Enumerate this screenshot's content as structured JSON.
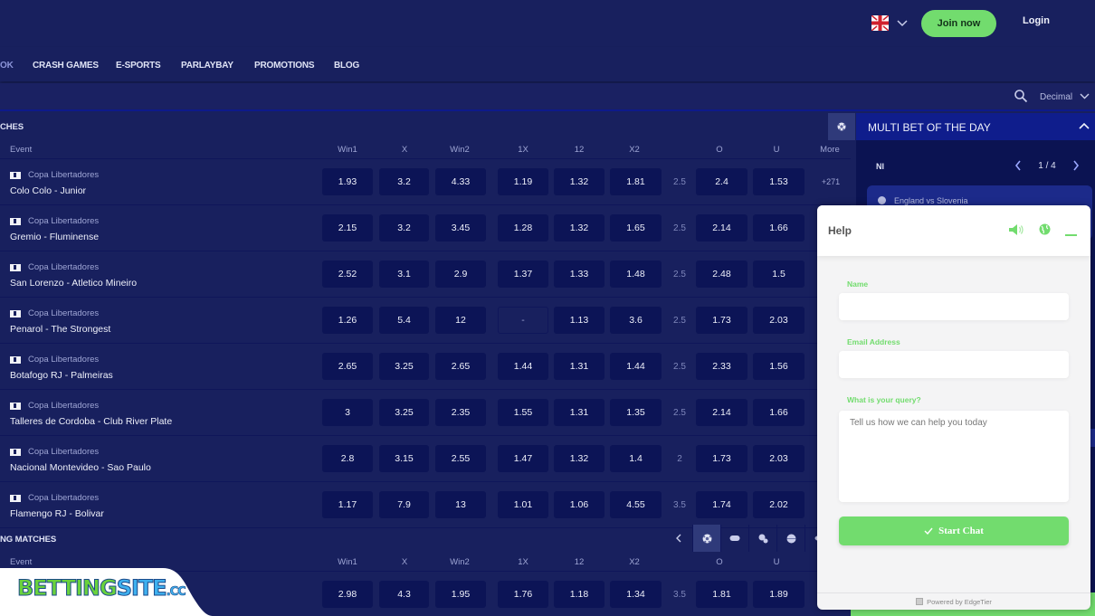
{
  "header": {
    "language_icon": "uk-flag-icon",
    "join_label": "Join now",
    "login_label": "Login"
  },
  "nav": {
    "items": [
      {
        "label": "OK",
        "active": true
      },
      {
        "label": "CRASH GAMES"
      },
      {
        "label": "E-SPORTS"
      },
      {
        "label": "PARLAYBAY"
      },
      {
        "label": "PROMOTIONS"
      },
      {
        "label": "BLOG"
      }
    ]
  },
  "toolbar": {
    "odds_format": "Decimal"
  },
  "columns": {
    "event": "Event",
    "win1": "Win1",
    "x": "X",
    "win2": "Win2",
    "dc1x": "1X",
    "dc12": "12",
    "dcx2": "X2",
    "over": "O",
    "under": "U",
    "more": "More"
  },
  "top_section": {
    "title": "CHES",
    "matches": [
      {
        "league": "Copa Libertadores",
        "name": "Colo Colo - Junior",
        "odds": [
          "1.93",
          "3.2",
          "4.33",
          "1.19",
          "1.32",
          "1.81"
        ],
        "line": "2.5",
        "ou": [
          "2.4",
          "1.53"
        ],
        "more": "+271"
      },
      {
        "league": "Copa Libertadores",
        "name": "Gremio - Fluminense",
        "odds": [
          "2.15",
          "3.2",
          "3.45",
          "1.28",
          "1.32",
          "1.65"
        ],
        "line": "2.5",
        "ou": [
          "2.14",
          "1.66"
        ],
        "more": ""
      },
      {
        "league": "Copa Libertadores",
        "name": "San Lorenzo - Atletico Mineiro",
        "odds": [
          "2.52",
          "3.1",
          "2.9",
          "1.37",
          "1.33",
          "1.48"
        ],
        "line": "2.5",
        "ou": [
          "2.48",
          "1.5"
        ],
        "more": ""
      },
      {
        "league": "Copa Libertadores",
        "name": "Penarol - The Strongest",
        "odds": [
          "1.26",
          "5.4",
          "12",
          "-",
          "1.13",
          "3.6"
        ],
        "line": "2.5",
        "ou": [
          "1.73",
          "2.03"
        ],
        "more": ""
      },
      {
        "league": "Copa Libertadores",
        "name": "Botafogo RJ - Palmeiras",
        "odds": [
          "2.65",
          "3.25",
          "2.65",
          "1.44",
          "1.31",
          "1.44"
        ],
        "line": "2.5",
        "ou": [
          "2.33",
          "1.56"
        ],
        "more": ""
      },
      {
        "league": "Copa Libertadores",
        "name": "Talleres de Cordoba - Club River Plate",
        "odds": [
          "3",
          "3.25",
          "2.35",
          "1.55",
          "1.31",
          "1.35"
        ],
        "line": "2.5",
        "ou": [
          "2.14",
          "1.66"
        ],
        "more": ""
      },
      {
        "league": "Copa Libertadores",
        "name": "Nacional Montevideo - Sao Paulo",
        "odds": [
          "2.8",
          "3.15",
          "2.55",
          "1.47",
          "1.32",
          "1.4"
        ],
        "line": "2",
        "ou": [
          "1.73",
          "2.03"
        ],
        "more": ""
      },
      {
        "league": "Copa Libertadores",
        "name": "Flamengo RJ - Bolivar",
        "odds": [
          "1.17",
          "7.9",
          "13",
          "1.01",
          "1.06",
          "4.55"
        ],
        "line": "3.5",
        "ou": [
          "1.74",
          "2.02"
        ],
        "more": ""
      }
    ]
  },
  "upcoming_section": {
    "title": "NG MATCHES",
    "sport_tabs": [
      "soccer-icon",
      "esports-icon",
      "tennis-icon",
      "basketball-icon",
      "hockey-icon"
    ],
    "matches": [
      {
        "odds": [
          "2.98",
          "4.3",
          "1.95",
          "1.76",
          "1.18",
          "1.34"
        ],
        "line": "3.5",
        "ou": [
          "1.81",
          "1.89"
        ]
      }
    ]
  },
  "multibet": {
    "title": "MULTI BET OF THE DAY",
    "league": "NI",
    "pager": "1 / 4",
    "event": "England vs Slovenia"
  },
  "chat": {
    "title": "Help",
    "name_label": "Name",
    "name_value": "",
    "email_label": "Email Address",
    "email_value": "",
    "query_label": "What is your query?",
    "query_placeholder": "Tell us how we can help you today",
    "start_label": "Start Chat",
    "powered_by": "Powered by EdgeTier"
  },
  "brand": {
    "part1": "BETTING",
    "part2": "SITE",
    "part3": ".CC"
  },
  "colors": {
    "background": "#18205e",
    "odds_cell": "#0c1456",
    "accent_green": "#72dc6e",
    "multibet_header": "#0f1d8c"
  }
}
